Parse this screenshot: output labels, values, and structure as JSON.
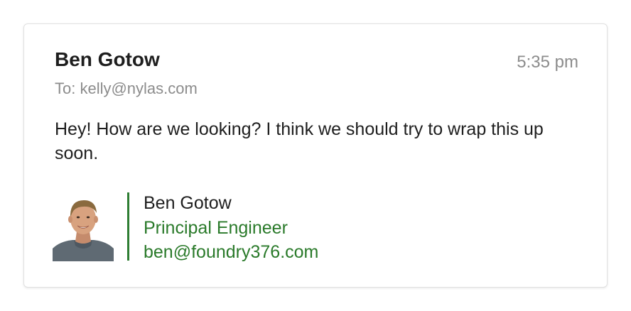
{
  "message": {
    "sender_name": "Ben Gotow",
    "time": "5:35 pm",
    "to_line": "To: kelly@nylas.com",
    "body": "Hey! How are we looking? I think we should try to wrap this up soon."
  },
  "signature": {
    "avatar_icon": "person-photo",
    "name": "Ben Gotow",
    "title": "Principal Engineer",
    "email": "ben@foundry376.com",
    "accent_color": "#2e7d32"
  }
}
